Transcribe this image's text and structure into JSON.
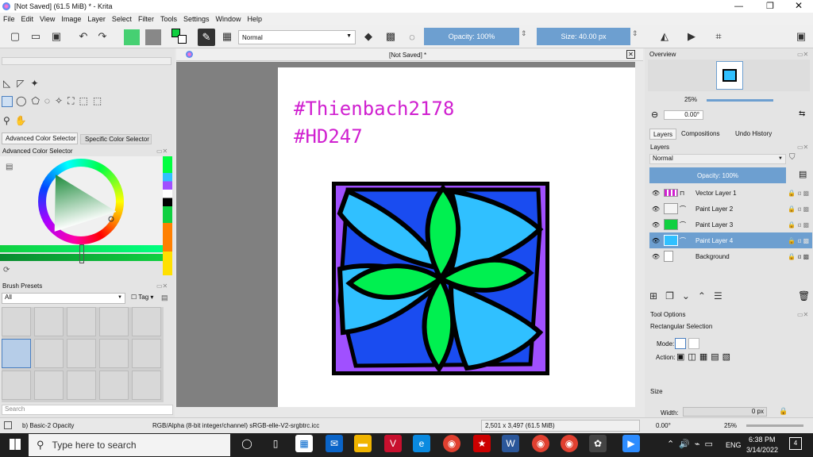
{
  "window": {
    "title": "[Not Saved]  (61.5 MiB)  * - Krita"
  },
  "menu": [
    "File",
    "Edit",
    "View",
    "Image",
    "Layer",
    "Select",
    "Filter",
    "Tools",
    "Settings",
    "Window",
    "Help"
  ],
  "toolbar": {
    "blend_mode": "Normal",
    "opacity": "Opacity: 100%",
    "size": "Size: 40.00 px"
  },
  "document": {
    "tab_title": "[Not Saved]  *"
  },
  "canvas": {
    "line1": "#Thienbach2178",
    "line2": "#HD247"
  },
  "color_selector": {
    "tab_advanced": "Advanced Color Selector",
    "tab_specific": "Specific Color Selector",
    "panel_title": "Advanced Color Selector"
  },
  "brush_presets": {
    "title": "Brush Presets",
    "filter": "All",
    "tag": "Tag",
    "search_placeholder": "Search"
  },
  "overview": {
    "title": "Overview",
    "zoom": "25%",
    "angle": "0.00°"
  },
  "layers_panel": {
    "tabs": [
      "Layers",
      "Compositions",
      "Undo History"
    ],
    "title": "Layers",
    "blend": "Normal",
    "opacity": "Opacity:  100%",
    "layers": [
      {
        "name": "Vector Layer 1"
      },
      {
        "name": "Paint Layer 2"
      },
      {
        "name": "Paint Layer 3"
      },
      {
        "name": "Paint Layer 4"
      },
      {
        "name": "Background"
      }
    ]
  },
  "tool_options": {
    "title": "Tool Options",
    "tool": "Rectangular Selection",
    "mode_label": "Mode:",
    "action_label": "Action:",
    "size_label": "Size",
    "width_label": "Width:",
    "width_value": "0 px"
  },
  "statusbar": {
    "brush": "b) Basic-2 Opacity",
    "colorspace": "RGB/Alpha (8-bit integer/channel)  sRGB-elle-V2-srgbtrc.icc",
    "dims": "2,501 x 3,497 (61.5 MiB)",
    "angle": "0.00°",
    "zoom": "25%"
  },
  "taskbar": {
    "search_placeholder": "Type here to search",
    "lang": "ENG",
    "time": "6:38 PM",
    "date": "3/14/2022",
    "notifications": "4"
  },
  "colors": {
    "accent": "#6d9fd0",
    "selected_layer": "#6d9fd0",
    "taskbar": "#1f1f1f",
    "canvas_text": "#d020d0",
    "panel_bg": "#e4e4e4"
  }
}
